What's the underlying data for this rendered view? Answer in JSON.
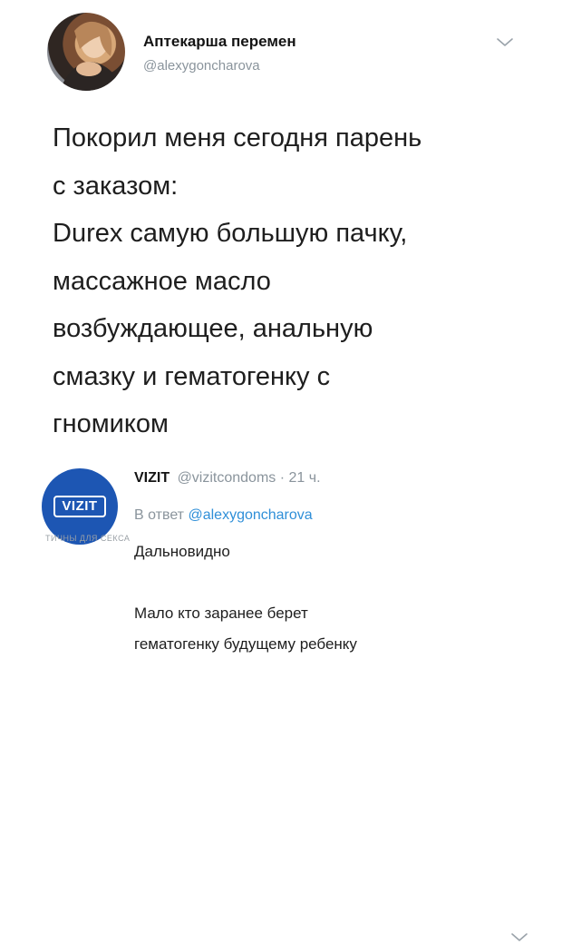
{
  "tweet": {
    "author_name": "Аптекарша перемен",
    "author_handle": "@alexygoncharova",
    "text_lines": [
      "Покорил меня сегодня парень",
      "с заказом:",
      "Durex самую большую пачку,",
      "массажное масло",
      "возбуждающее, анальную",
      "смазку и гематогенку с",
      "гномиком"
    ],
    "menu_icon": "chevron-down-icon"
  },
  "reply": {
    "author_name": "VIZIT",
    "meta": "@vizitcondoms · 21 ч.",
    "in_reply_prefix": "В ответ",
    "in_reply_handle": "@alexygoncharova",
    "avatar_logo_text": "VIZIT",
    "watermark": "ТИЧНЫ ДЛЯ СЕКСА",
    "text_lines": [
      "Дальновидно",
      "Мало кто заранее берет",
      "гематогенку будущему ребенку"
    ],
    "menu_icon": "chevron-down-icon"
  },
  "colors": {
    "text": "#1e1e1e",
    "muted": "#8a949c",
    "link": "#2f8fd8",
    "vizit_blue": "#1d56b3"
  }
}
